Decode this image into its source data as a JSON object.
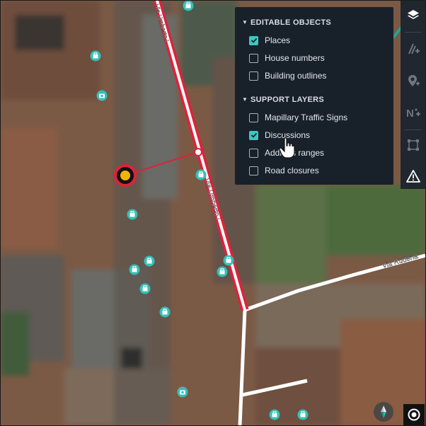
{
  "map": {
    "streets": [
      {
        "name": "Via Umberto I",
        "highlighted": true
      },
      {
        "name": "Via Umberto I",
        "highlighted": true
      },
      {
        "name": "Via Rudena",
        "highlighted": false
      }
    ],
    "colors": {
      "selected_road": "#e0213b",
      "road": "#ffffff",
      "poi": "#34c0b8",
      "selected_node": "#f3b400",
      "arrow": "#1fa39a"
    }
  },
  "layers_panel": {
    "editable_section": {
      "title": "EDITABLE OBJECTS",
      "items": [
        {
          "label": "Places",
          "checked": true
        },
        {
          "label": "House numbers",
          "checked": false
        },
        {
          "label": "Building outlines",
          "checked": false
        }
      ]
    },
    "support_section": {
      "title": "SUPPORT LAYERS",
      "items": [
        {
          "label": "Mapillary Traffic Signs",
          "checked": false
        },
        {
          "label": "Discussions",
          "checked": true
        },
        {
          "label": "Address ranges",
          "checked": false
        },
        {
          "label": "Road closures",
          "checked": false
        }
      ]
    }
  },
  "toolbar": {
    "buttons": [
      "layers-icon",
      "add-road-icon",
      "add-place-icon",
      "add-street-name-icon",
      "draw-area-icon",
      "warning-icon"
    ]
  },
  "controls": {
    "compass": "compass-icon",
    "locate": "locate-icon"
  }
}
